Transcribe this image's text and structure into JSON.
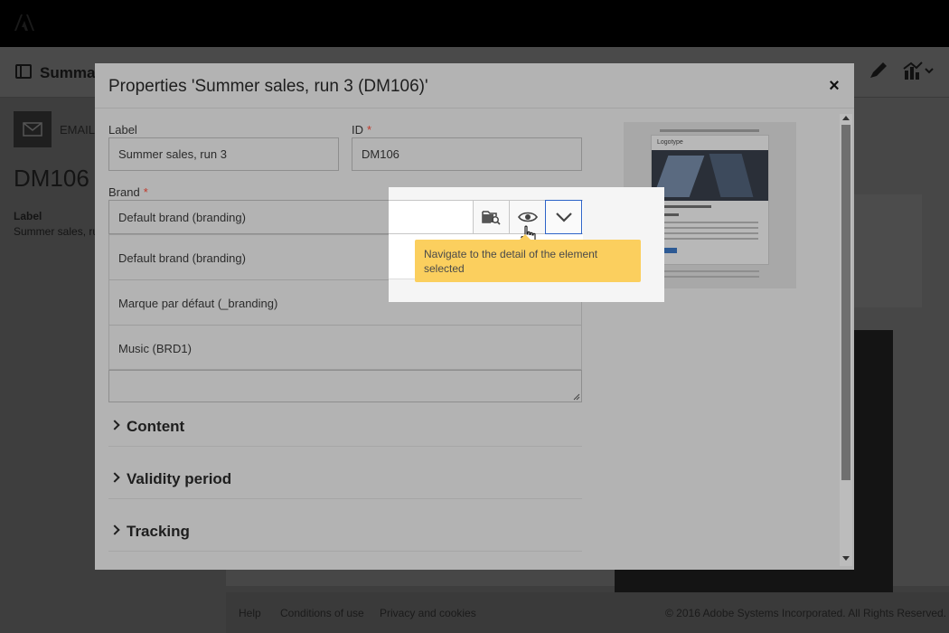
{
  "app": {
    "bg_title": "Summar",
    "email_label": "EMAIL",
    "delivery_code": "DM106",
    "label_caption": "Label",
    "label_value": "Summer sales, ru"
  },
  "footer": {
    "help": "Help",
    "conditions": "Conditions of use",
    "privacy": "Privacy and cookies",
    "copyright": "© 2016 Adobe Systems Incorporated. All Rights Reserved."
  },
  "modal": {
    "title": "Properties 'Summer sales, run 3 (DM106)'",
    "close_symbol": "×",
    "label_field": {
      "label": "Label",
      "value": "Summer sales, run 3"
    },
    "id_field": {
      "label": "ID",
      "required_mark": "*",
      "value": "DM106"
    },
    "brand_field": {
      "label": "Brand",
      "required_mark": "*",
      "selected": "Default brand (branding)",
      "options": [
        "Default brand (branding)",
        "Marque par défaut (_branding)",
        "Music (BRD1)"
      ]
    },
    "sections": [
      {
        "title": "Content"
      },
      {
        "title": "Validity period"
      },
      {
        "title": "Tracking"
      }
    ],
    "preview": {
      "logo_text": "Logotype"
    }
  },
  "tooltip": {
    "text": "Navigate to the detail of the element selected"
  },
  "colors": {
    "accent_blue": "#2d63c8",
    "tooltip_yellow": "#fbcf5e",
    "required_red": "#c0392b"
  }
}
